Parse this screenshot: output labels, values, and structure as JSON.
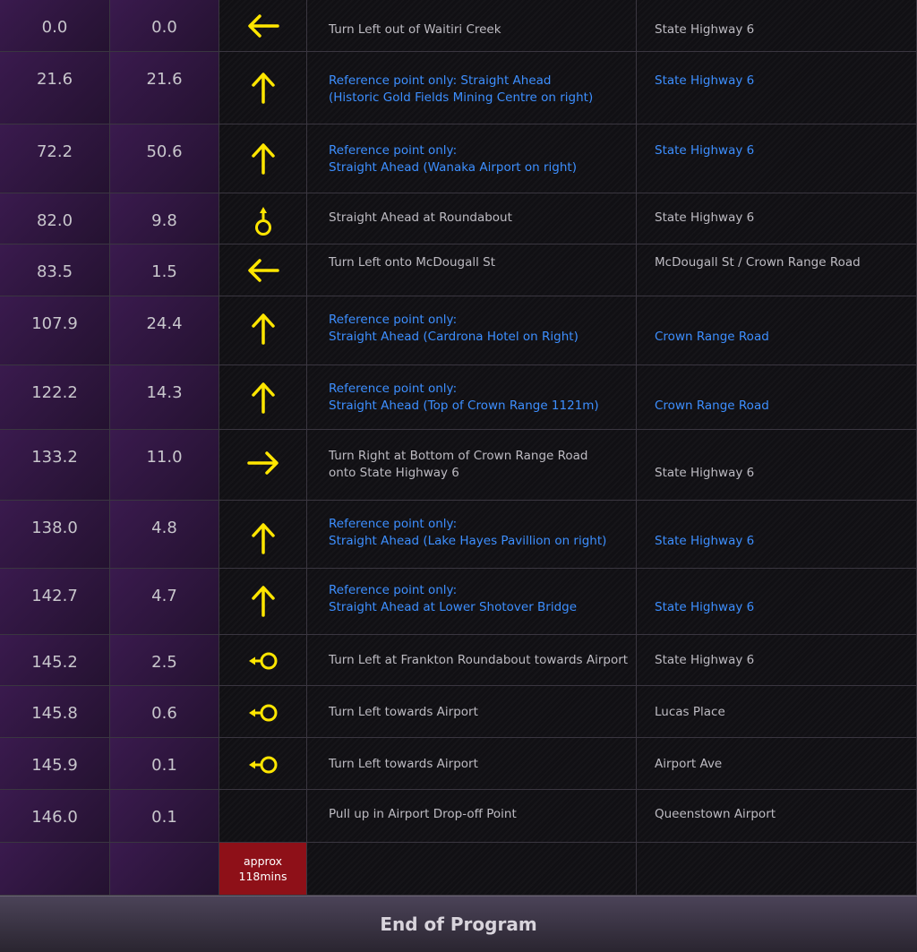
{
  "rows": [
    {
      "total": "0.0",
      "leg": "0.0",
      "icon": "arrow-left-icon",
      "instruction": "Turn Left out of Waitiri Creek",
      "road": "State Highway 6",
      "ref": false
    },
    {
      "total": "21.6",
      "leg": "21.6",
      "icon": "arrow-up-icon",
      "instruction": "Reference point only: Straight Ahead\n(Historic Gold Fields Mining Centre on right)",
      "road": "State Highway 6",
      "ref": true
    },
    {
      "total": "72.2",
      "leg": "50.6",
      "icon": "arrow-up-icon",
      "instruction": "Reference point only:\nStraight Ahead (Wanaka Airport on right)",
      "road": "State Highway 6",
      "ref": true
    },
    {
      "total": "82.0",
      "leg": "9.8",
      "icon": "roundabout-straight-icon",
      "instruction": "Straight Ahead at Roundabout",
      "road": "State Highway 6",
      "ref": false
    },
    {
      "total": "83.5",
      "leg": "1.5",
      "icon": "arrow-left-icon",
      "instruction": "Turn Left onto McDougall St",
      "road": "McDougall St / Crown Range Road",
      "ref": false
    },
    {
      "total": "107.9",
      "leg": "24.4",
      "icon": "arrow-up-icon",
      "instruction": "Reference point only:\nStraight Ahead (Cardrona Hotel on Right)",
      "road": "Crown Range Road",
      "ref": true
    },
    {
      "total": "122.2",
      "leg": "14.3",
      "icon": "arrow-up-icon",
      "instruction": "Reference point only:\nStraight Ahead (Top of Crown Range 1121m)",
      "road": "Crown Range Road",
      "ref": true
    },
    {
      "total": "133.2",
      "leg": "11.0",
      "icon": "arrow-right-icon",
      "instruction": "Turn Right at Bottom of Crown Range Road\nonto State Highway 6",
      "road": "State Highway 6",
      "ref": false
    },
    {
      "total": "138.0",
      "leg": "4.8",
      "icon": "arrow-up-icon",
      "instruction": "Reference point only:\nStraight Ahead (Lake Hayes Pavillion on right)",
      "road": "State Highway 6",
      "ref": true
    },
    {
      "total": "142.7",
      "leg": "4.7",
      "icon": "arrow-up-icon",
      "instruction": "Reference point only:\nStraight Ahead at Lower Shotover Bridge",
      "road": "State Highway 6",
      "ref": true
    },
    {
      "total": "145.2",
      "leg": "2.5",
      "icon": "roundabout-left-icon",
      "instruction": "Turn Left at Frankton Roundabout towards Airport",
      "road": "State Highway 6",
      "ref": false
    },
    {
      "total": "145.8",
      "leg": "0.6",
      "icon": "roundabout-left-icon",
      "instruction": "Turn Left towards Airport",
      "road": "Lucas Place",
      "ref": false
    },
    {
      "total": "145.9",
      "leg": "0.1",
      "icon": "roundabout-left-icon",
      "instruction": "Turn Left towards Airport",
      "road": "Airport Ave",
      "ref": false
    },
    {
      "total": "146.0",
      "leg": "0.1",
      "icon": "",
      "instruction": "Pull up in Airport Drop-off Point",
      "road": "Queenstown Airport",
      "ref": false
    }
  ],
  "summary": {
    "approx_line1": "approx",
    "approx_line2": "118mins"
  },
  "footer": {
    "label": "End of Program"
  },
  "colors": {
    "accent": "#ffe600",
    "reference_text": "#3d8fff",
    "badge": "#8e1018"
  }
}
